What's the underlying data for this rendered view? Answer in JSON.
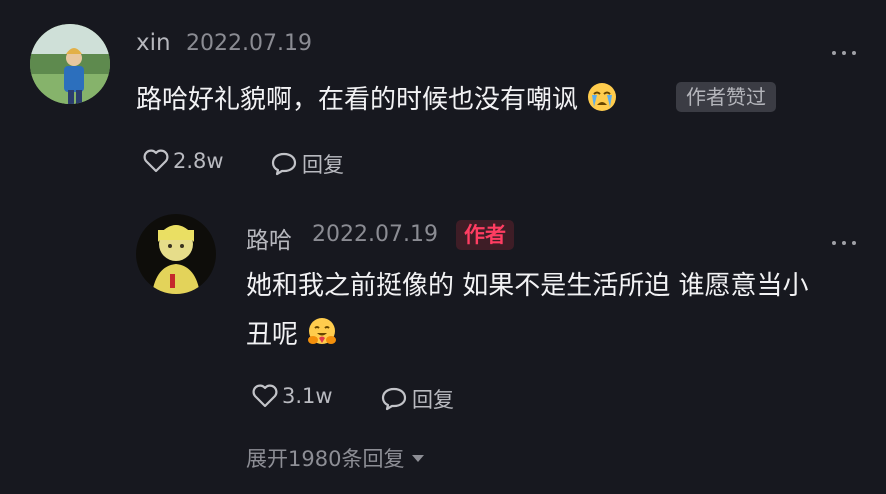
{
  "comment": {
    "username": "xin",
    "date": "2022.07.19",
    "text": "路哈好礼貌啊，在看的时候也没有嘲讽",
    "emoji": "crying-face-emoji",
    "liked_badge": "作者赞过",
    "likes": "2.8w",
    "reply_label": "回复"
  },
  "reply": {
    "username": "路哈",
    "date": "2022.07.19",
    "author_tag": "作者",
    "text_line1": "她和我之前挺像的 如果不是生活所迫 谁愿意当小",
    "text_line2": "丑呢",
    "emoji": "hugging-face-emoji",
    "likes": "3.1w",
    "reply_label": "回复"
  },
  "expand_replies": "展开1980条回复",
  "colors": {
    "background": "#17181f",
    "author_tag_text": "#ff3d62",
    "author_tag_bg": "#3e1d26",
    "badge_bg": "#3b3c44"
  }
}
